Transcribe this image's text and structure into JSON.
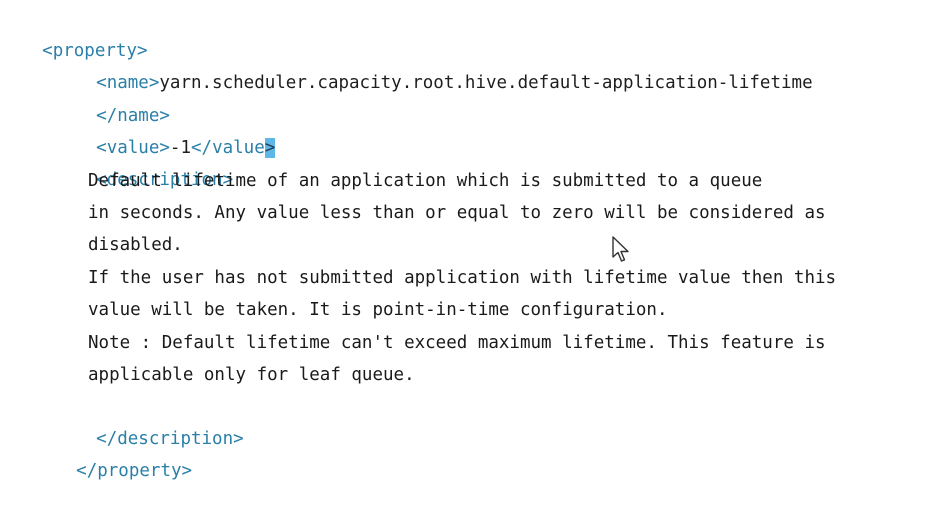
{
  "lines": {
    "property_open": "<property>",
    "name_open": "<name>",
    "name_value": "yarn.scheduler.capacity.root.hive.default-application-lifetime",
    "name_close": "</name>",
    "value_open": "<value>",
    "value_value": "-1",
    "value_close_main": "</value",
    "value_close_selected": ">",
    "description_open": "<description>",
    "desc_1": "Default lifetime of an application which is submitted to a queue",
    "desc_2": "in seconds. Any value less than or equal to zero will be considered as",
    "desc_3": "disabled.",
    "desc_4": "If the user has not submitted application with lifetime value then this",
    "desc_5": "value will be taken. It is point-in-time configuration.",
    "desc_6": "Note : Default lifetime can't exceed maximum lifetime. This feature is",
    "desc_7": "applicable only for leaf queue.",
    "description_close": "</description>",
    "property_close": "</property>"
  },
  "colors": {
    "tag": "#2a7fa8",
    "text": "#1e1e1e",
    "selection": "#5fb7e8",
    "background": "#ffffff"
  },
  "icons": {
    "cursor": "mouse-pointer-icon"
  }
}
